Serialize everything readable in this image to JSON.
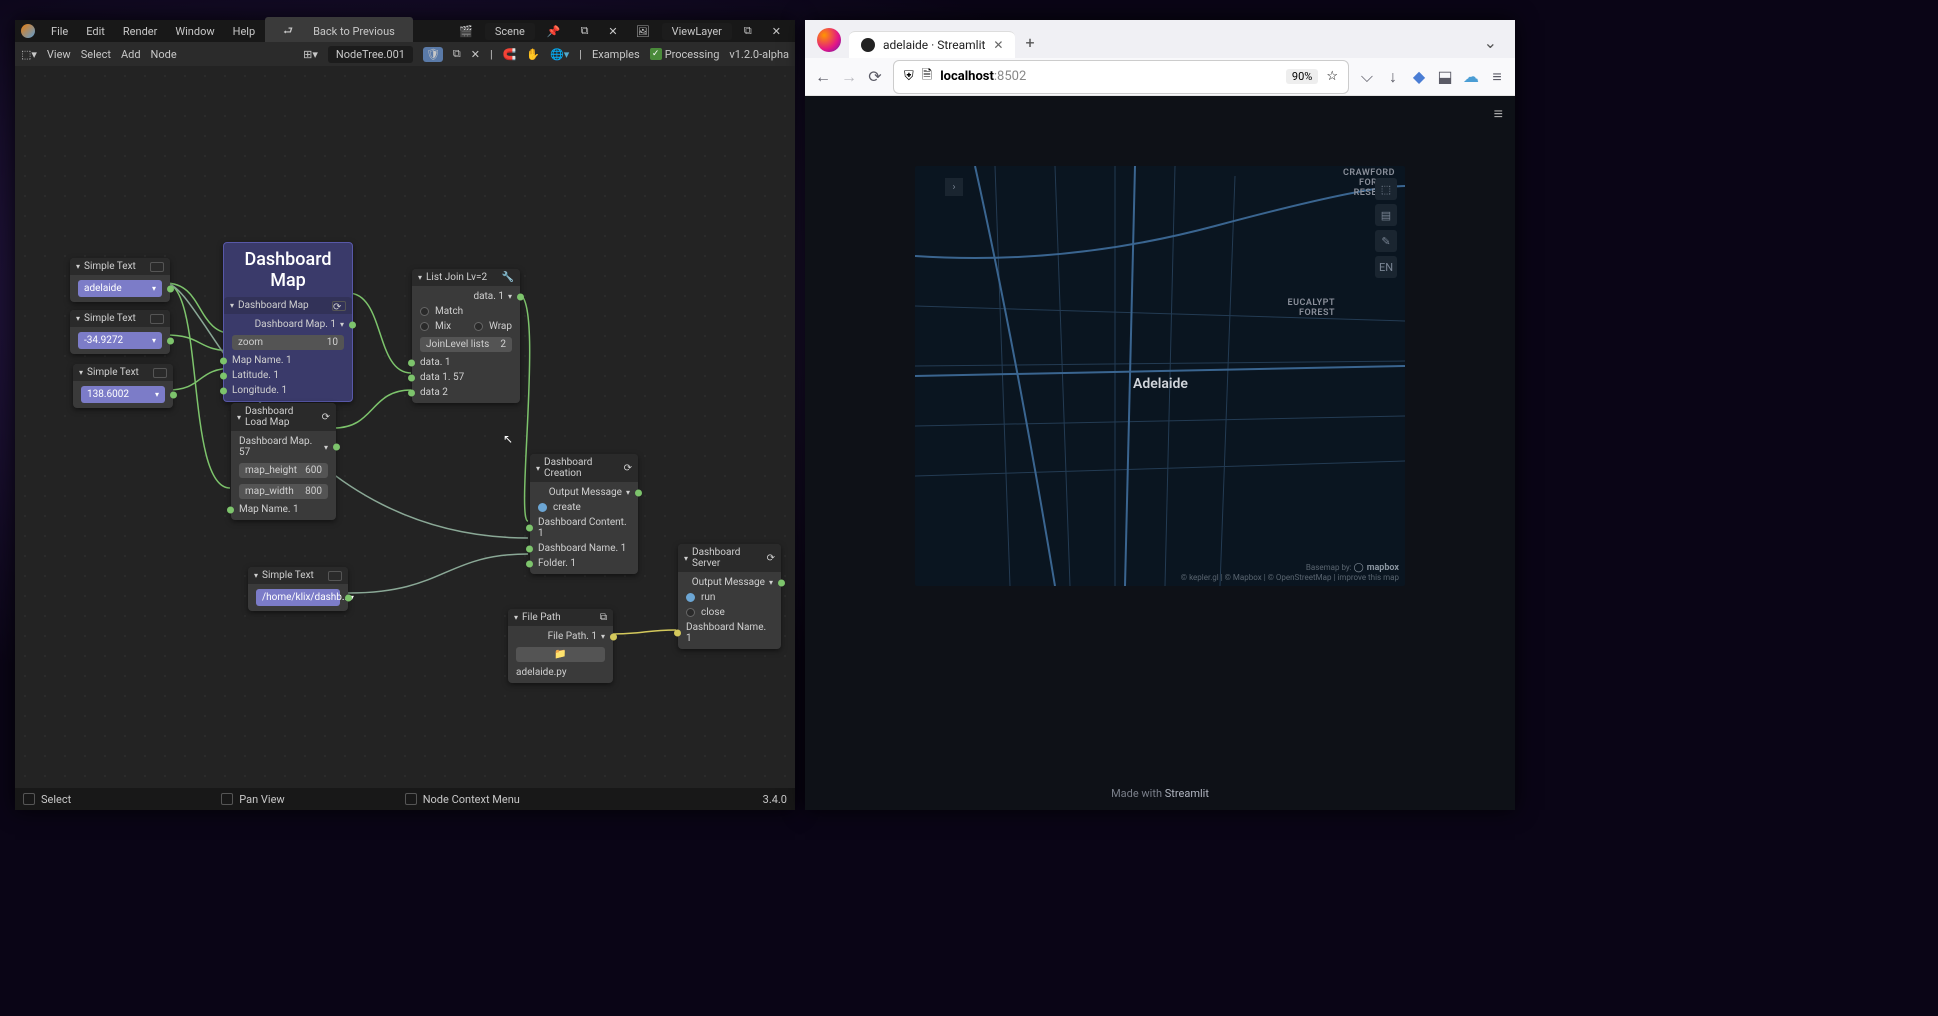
{
  "blender": {
    "menubar": {
      "file": "File",
      "edit": "Edit",
      "render": "Render",
      "window": "Window",
      "help": "Help",
      "back": "Back to Previous",
      "scene": "Scene",
      "viewlayer": "ViewLayer"
    },
    "toolbar": {
      "view": "View",
      "select": "Select",
      "add": "Add",
      "node": "Node",
      "nodetree": "NodeTree.001",
      "examples": "Examples",
      "processing": "Processing",
      "version": "v1.2.0-alpha"
    },
    "footer": {
      "select": "Select",
      "pan": "Pan View",
      "context": "Node Context Menu",
      "ver": "3.4.0"
    },
    "nodes": {
      "simple1": {
        "title": "Simple Text",
        "value": "adelaide"
      },
      "simple2": {
        "title": "Simple Text",
        "value": "-34.9272"
      },
      "simple3": {
        "title": "Simple Text",
        "value": "138.6002"
      },
      "simple4": {
        "title": "Simple Text",
        "value": "/home/klix/dashb..."
      },
      "dashmap": {
        "bigtitle": "Dashboard Map",
        "title": "Dashboard Map",
        "out": "Dashboard Map. 1",
        "zoom_l": "zoom",
        "zoom_v": "10",
        "in1": "Map Name. 1",
        "in2": "Latitude. 1",
        "in3": "Longitude. 1"
      },
      "loadmap": {
        "title": "Dashboard Load Map",
        "out": "Dashboard Map. 57",
        "h_l": "map_height",
        "h_v": "600",
        "w_l": "map_width",
        "w_v": "800",
        "in": "Map Name. 1"
      },
      "listjoin": {
        "title": "List Join Lv=2",
        "out": "data. 1",
        "match": "Match",
        "mix": "Mix",
        "wrap": "Wrap",
        "jl_l": "JoinLevel lists",
        "jl_v": "2",
        "in1": "data. 1",
        "in2": "data 1. 57",
        "in3": "data 2"
      },
      "creation": {
        "title": "Dashboard Creation",
        "out": "Output Message",
        "create": "create",
        "in1": "Dashboard Content. 1",
        "in2": "Dashboard Name. 1",
        "in3": "Folder. 1"
      },
      "server": {
        "title": "Dashboard Server",
        "out": "Output Message",
        "run": "run",
        "close": "close",
        "in": "Dashboard Name. 1"
      },
      "filepath": {
        "title": "File Path",
        "out": "File Path. 1",
        "file": "adelaide.py"
      }
    }
  },
  "browser": {
    "tab_title": "adelaide · Streamlit",
    "url_host": "localhost",
    "url_port": ":8502",
    "zoom": "90%",
    "map": {
      "city": "Adelaide",
      "area1": "CRAWFORD\nFOREST\nRESERVE",
      "area2": "EUCALYPT\nFOREST",
      "lang": "EN",
      "basemap": "Basemap by:",
      "mapbox": "mapbox",
      "attrib": "© kepler.gl | © Mapbox | © OpenStreetMap | improve this map"
    },
    "madewith": "Made with ",
    "streamlit": "Streamlit"
  }
}
